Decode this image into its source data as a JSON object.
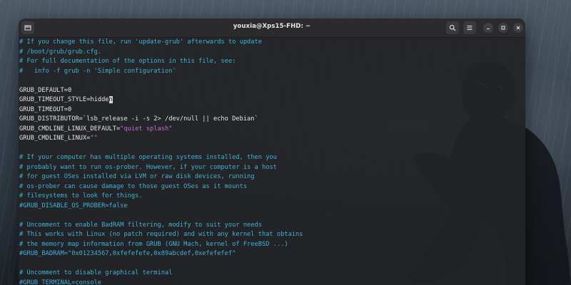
{
  "window": {
    "title": "youxia@Xps15-FHD: ~"
  },
  "icons": {
    "new_tab": "new-tab-icon",
    "search": "search-icon",
    "menu": "hamburger-menu-icon",
    "minimize": "minimize-icon",
    "maximize": "maximize-icon",
    "close": "close-icon"
  },
  "colors": {
    "comment": "#3fb2d6",
    "string": "#c76bd6",
    "text": "#e3e3e3",
    "background": "#222326"
  },
  "editor": {
    "lines": [
      {
        "segments": [
          {
            "text": "# If you change this file, run 'update-grub' afterwards to update",
            "kind": "comment"
          }
        ]
      },
      {
        "segments": [
          {
            "text": "# /boot/grub/grub.cfg.",
            "kind": "comment"
          }
        ]
      },
      {
        "segments": [
          {
            "text": "# For full documentation of the options in this file, see:",
            "kind": "comment"
          }
        ]
      },
      {
        "segments": [
          {
            "text": "#   info -f grub -n 'Simple configuration'",
            "kind": "comment"
          }
        ]
      },
      {
        "segments": [
          {
            "text": "",
            "kind": "plain"
          }
        ]
      },
      {
        "segments": [
          {
            "text": "GRUB_DEFAULT=0",
            "kind": "plain"
          }
        ]
      },
      {
        "segments": [
          {
            "text": "GRUB_TIMEOUT_STYLE=hidde",
            "kind": "plain"
          },
          {
            "text": "n",
            "kind": "cursor"
          }
        ]
      },
      {
        "segments": [
          {
            "text": "GRUB_TIMEOUT=0",
            "kind": "plain"
          }
        ]
      },
      {
        "segments": [
          {
            "text": "GRUB_DISTRIBUTOR=`lsb_release -i -s 2> /dev/null || echo Debian`",
            "kind": "plain"
          }
        ]
      },
      {
        "segments": [
          {
            "text": "GRUB_CMDLINE_LINUX_DEFAULT=",
            "kind": "plain"
          },
          {
            "text": "\"quiet splash\"",
            "kind": "string"
          }
        ]
      },
      {
        "segments": [
          {
            "text": "GRUB_CMDLINE_LINUX=",
            "kind": "plain"
          },
          {
            "text": "\"\"",
            "kind": "string"
          }
        ]
      },
      {
        "segments": [
          {
            "text": "",
            "kind": "plain"
          }
        ]
      },
      {
        "segments": [
          {
            "text": "# If your computer has multiple operating systems installed, then you",
            "kind": "comment"
          }
        ]
      },
      {
        "segments": [
          {
            "text": "# probably want to run os-prober. However, if your computer is a host",
            "kind": "comment"
          }
        ]
      },
      {
        "segments": [
          {
            "text": "# for guest OSes installed via LVM or raw disk devices, running",
            "kind": "comment"
          }
        ]
      },
      {
        "segments": [
          {
            "text": "# os-prober can cause damage to those guest OSes as it mounts",
            "kind": "comment"
          }
        ]
      },
      {
        "segments": [
          {
            "text": "# filesystems to look for things.",
            "kind": "comment"
          }
        ]
      },
      {
        "segments": [
          {
            "text": "#GRUB_DISABLE_OS_PROBER=false",
            "kind": "comment"
          }
        ]
      },
      {
        "segments": [
          {
            "text": "",
            "kind": "plain"
          }
        ]
      },
      {
        "segments": [
          {
            "text": "# Uncomment to enable BadRAM filtering, modify to suit your needs",
            "kind": "comment"
          }
        ]
      },
      {
        "segments": [
          {
            "text": "# This works with Linux (no patch required) and with any kernel that obtains",
            "kind": "comment"
          }
        ]
      },
      {
        "segments": [
          {
            "text": "# the memory map information from GRUB (GNU Mach, kernel of FreeBSD ...)",
            "kind": "comment"
          }
        ]
      },
      {
        "segments": [
          {
            "text": "#GRUB_BADRAM=\"0x01234567,0xfefefefe,0x89abcdef,0xefefefef\"",
            "kind": "comment"
          }
        ]
      },
      {
        "segments": [
          {
            "text": "",
            "kind": "plain"
          }
        ]
      },
      {
        "segments": [
          {
            "text": "# Uncomment to disable graphical terminal",
            "kind": "comment"
          }
        ]
      },
      {
        "segments": [
          {
            "text": "#GRUB_TERMINAL=console",
            "kind": "comment"
          }
        ]
      }
    ]
  }
}
